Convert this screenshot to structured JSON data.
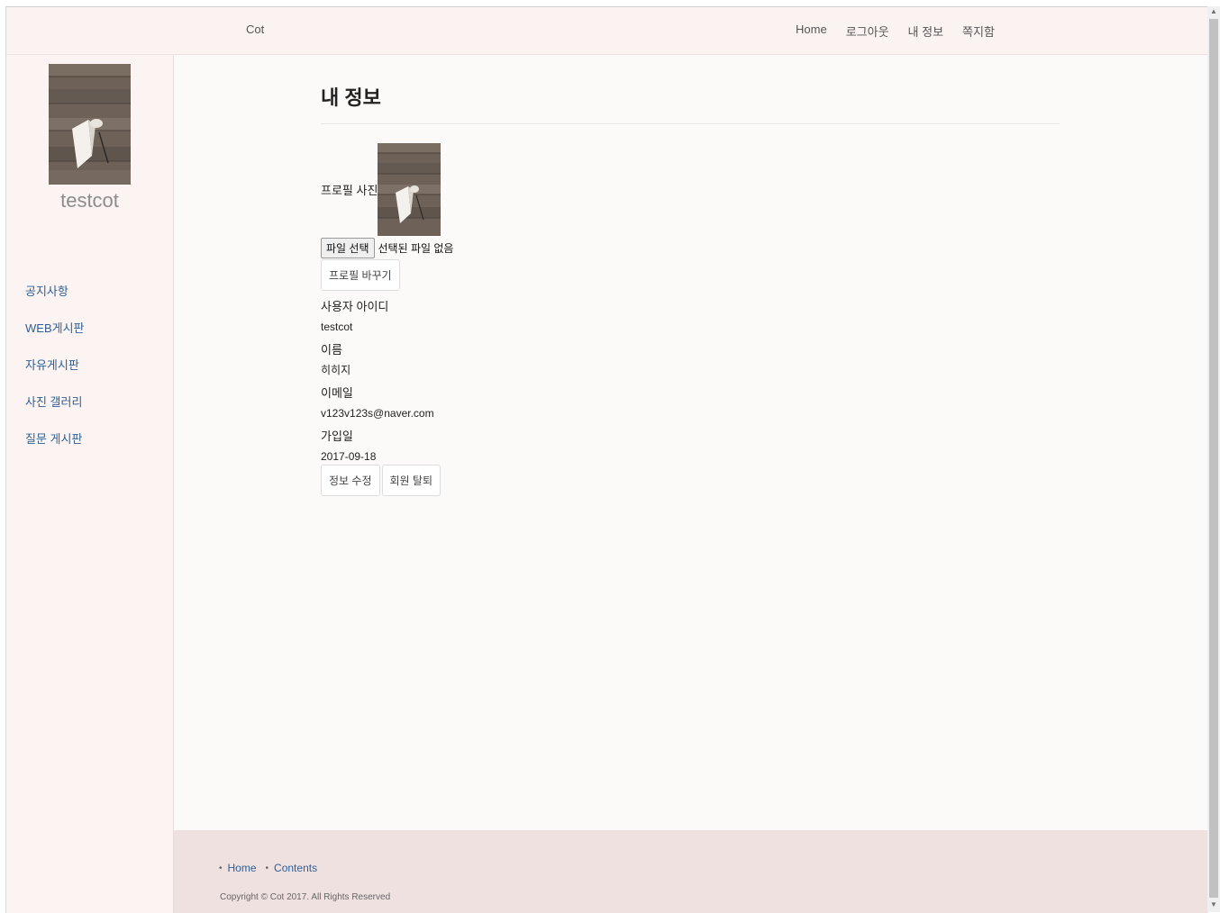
{
  "header": {
    "brand": "Cot",
    "nav": [
      "Home",
      "로그아웃",
      "내 정보",
      "쪽지함"
    ]
  },
  "sidebar": {
    "username": "testcot",
    "menu": [
      "공지사항",
      "WEB게시판",
      "자유게시판",
      "사진 갤러리",
      "질문 게시판"
    ]
  },
  "main": {
    "title": "내 정보",
    "profile_label": "프로필 사진",
    "file_button": "파일 선택",
    "file_status": "선택된 파일 없음",
    "change_button": "프로필 바꾸기",
    "fields": [
      {
        "label": "사용자 아이디",
        "value": "testcot"
      },
      {
        "label": "이름",
        "value": "히히지"
      },
      {
        "label": "이메일",
        "value": "v123v123s@naver.com"
      },
      {
        "label": "가입일",
        "value": "2017-09-18"
      }
    ],
    "edit_button": "정보 수정",
    "withdraw_button": "회원 탈퇴"
  },
  "footer": {
    "links": [
      "Home",
      "Contents"
    ],
    "copyright": "Copyright © Cot 2017. All Rights Reserved"
  },
  "colors": {
    "link_blue": "#2f5f95",
    "topbar_bg": "#fbf3f2",
    "footer_bg": "#f0e1e1"
  }
}
